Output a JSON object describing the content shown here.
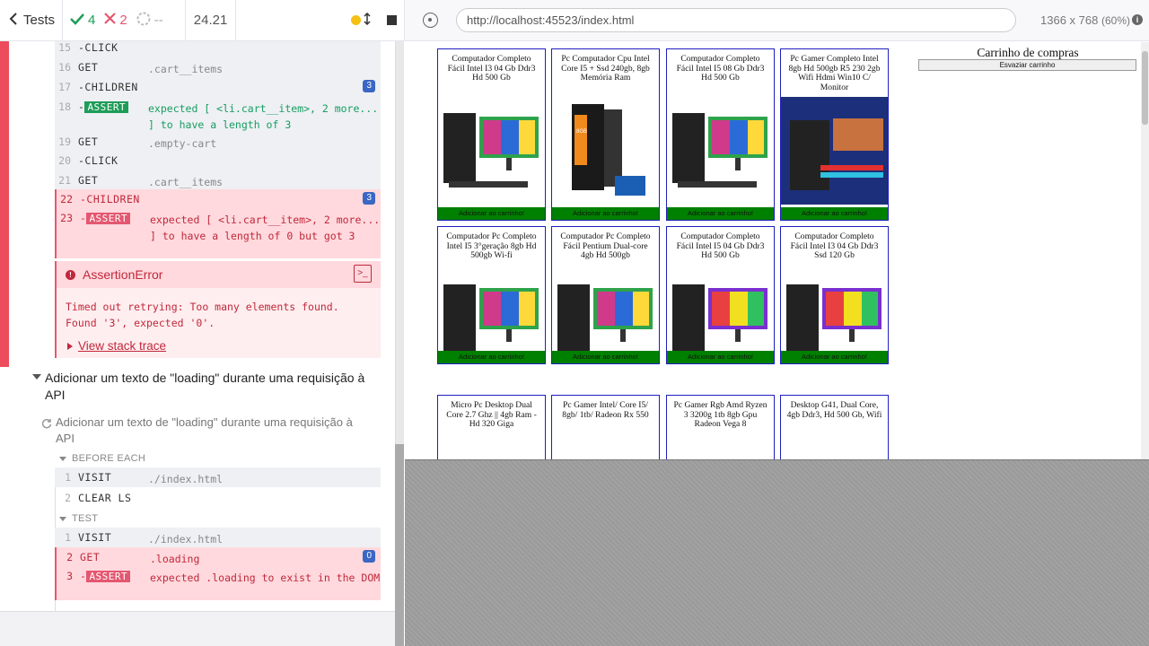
{
  "header": {
    "tests_label": "Tests",
    "passed": "4",
    "failed": "2",
    "pending": "--",
    "duration": "24.21"
  },
  "commands_top": [
    {
      "num": "15",
      "name": "-CLICK",
      "msg": ""
    },
    {
      "num": "16",
      "name": "GET",
      "msg": ".cart__items"
    },
    {
      "num": "17",
      "name": "-CHILDREN",
      "msg": "",
      "badge": "3"
    },
    {
      "num": "18",
      "name": "-ASSERT",
      "msg": "expected [ <li.cart__item>, 2 more... ] to have a length of 3"
    },
    {
      "num": "19",
      "name": "GET",
      "msg": ".empty-cart"
    },
    {
      "num": "20",
      "name": "-CLICK",
      "msg": ""
    },
    {
      "num": "21",
      "name": "GET",
      "msg": ".cart__items"
    },
    {
      "num": "22",
      "name": "-CHILDREN",
      "msg": "",
      "badge": "3"
    },
    {
      "num": "23",
      "name": "-ASSERT",
      "msg": "expected [ <li.cart__item>, 2 more... ] to have a length of 0 but got 3"
    }
  ],
  "error": {
    "title": "AssertionError",
    "message": "Timed out retrying: Too many elements found. Found '3', expected '0'.",
    "trace_link": "View stack trace"
  },
  "suite": {
    "title": "Adicionar um texto de \"loading\" durante uma requisição à API",
    "test_title": "Adicionar um texto de \"loading\" durante uma requisição à API",
    "before_each_label": "BEFORE EACH",
    "test_label": "TEST",
    "before_each": [
      {
        "num": "1",
        "name": "VISIT",
        "msg": "./index.html"
      },
      {
        "num": "2",
        "name": "CLEAR LS",
        "msg": ""
      }
    ],
    "test": [
      {
        "num": "1",
        "name": "VISIT",
        "msg": "./index.html"
      },
      {
        "num": "2",
        "name": "GET",
        "msg": ".loading",
        "badge": "0"
      },
      {
        "num": "3",
        "name": "-ASSERT",
        "msg": "expected .loading to exist in the DOM"
      }
    ]
  },
  "aut": {
    "url": "http://localhost:45523/index.html",
    "viewport": "1366 x 768",
    "scale": "(60%)"
  },
  "products": [
    {
      "title": "Computador Completo Fácil Intel I3 04 Gb Ddr3 Hd 500 Gb",
      "button": "Adicionar ao carrinho!"
    },
    {
      "title": "Pc Computador Cpu Intel Core I5 + Ssd 240gb, 8gb Memória Ram",
      "button": "Adicionar ao carrinho!"
    },
    {
      "title": "Computador Completo Fácil Intel I5 08 Gb Ddr3 Hd 500 Gb",
      "button": "Adicionar ao carrinho!"
    },
    {
      "title": "Pc Gamer Completo Intel 8gb Hd 500gb R5 230 2gb Wifi Hdmi Win10 C/ Monitor",
      "button": "Adicionar ao carrinho!"
    },
    {
      "title": "Computador Pc Completo Intel I5 3°geração 8gb Hd 500gb Wi-fi",
      "button": "Adicionar ao carrinho!"
    },
    {
      "title": "Computador Pc Completo Fácil Pentium Dual-core 4gb Hd 500gb",
      "button": "Adicionar ao carrinho!"
    },
    {
      "title": "Computador Completo Fácil Intel I5 04 Gb Ddr3 Hd 500 Gb",
      "button": "Adicionar ao carrinho!"
    },
    {
      "title": "Computador Completo Fácil Intel I3 04 Gb Ddr3 Ssd 120 Gb",
      "button": "Adicionar ao carrinho!"
    },
    {
      "title": "Micro Pc Desktop Dual Core 2.7 Ghz || 4gb Ram - Hd 320 Giga",
      "button": ""
    },
    {
      "title": "Pc Gamer Intel/ Core I5/ 8gb/ 1tb/ Radeon Rx 550",
      "button": ""
    },
    {
      "title": "Pc Gamer Rgb Amd Ryzen 3 3200g 1tb 8gb Gpu Radeon Vega 8",
      "button": ""
    },
    {
      "title": "Desktop G41, Dual Core, 4gb Ddr3, Hd 500 Gb, Wifi",
      "button": ""
    }
  ],
  "cart": {
    "title": "Carrinho de compras",
    "empty_button": "Esvaziar carrinho"
  }
}
